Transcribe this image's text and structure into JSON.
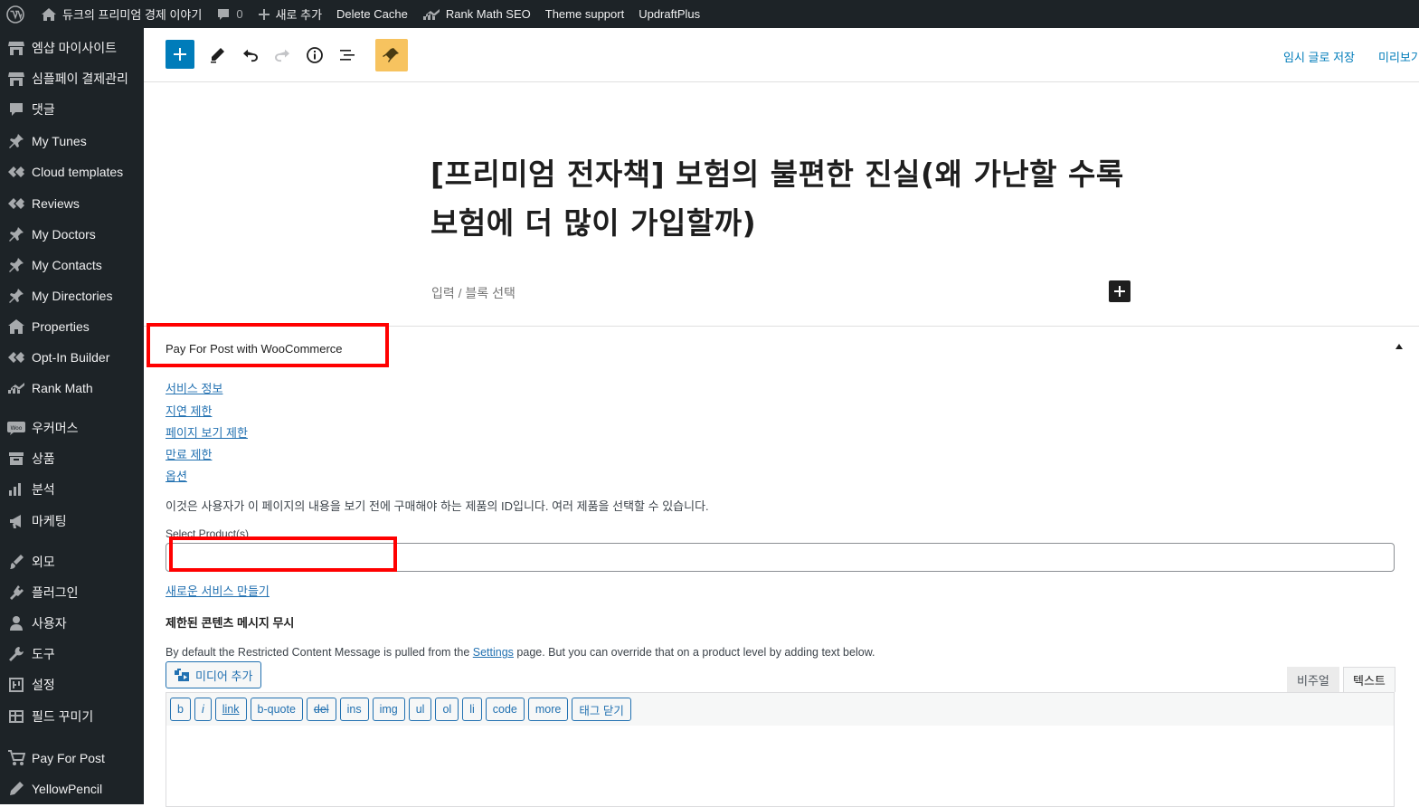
{
  "adminbar": {
    "site_name": "듀크의 프리미엄 경제 이야기",
    "comments_count": "0",
    "new_label": "새로 추가",
    "delete_cache": "Delete Cache",
    "rank_math": "Rank Math SEO",
    "theme_support": "Theme support",
    "updraftplus": "UpdraftPlus"
  },
  "sidebar": {
    "items": [
      {
        "label": "엠샵 마이사이트",
        "icon": "store-icon"
      },
      {
        "label": "심플페이 결제관리",
        "icon": "store-icon"
      },
      {
        "label": "댓글",
        "icon": "comment-icon"
      },
      {
        "label": "My Tunes",
        "icon": "pin-icon"
      },
      {
        "label": "Cloud templates",
        "icon": "elementor-icon"
      },
      {
        "label": "Reviews",
        "icon": "elementor-icon"
      },
      {
        "label": "My Doctors",
        "icon": "pin-icon"
      },
      {
        "label": "My Contacts",
        "icon": "pin-icon"
      },
      {
        "label": "My Directories",
        "icon": "pin-icon"
      },
      {
        "label": "Properties",
        "icon": "building-icon"
      },
      {
        "label": "Opt-In Builder",
        "icon": "elementor-icon"
      },
      {
        "label": "Rank Math",
        "icon": "rank-math-icon"
      },
      {
        "label": "우커머스",
        "icon": "woo-icon"
      },
      {
        "label": "상품",
        "icon": "archive-icon"
      },
      {
        "label": "분석",
        "icon": "bar-chart-icon"
      },
      {
        "label": "마케팅",
        "icon": "megaphone-icon"
      },
      {
        "label": "외모",
        "icon": "brush-icon"
      },
      {
        "label": "플러그인",
        "icon": "plugin-icon"
      },
      {
        "label": "사용자",
        "icon": "user-icon"
      },
      {
        "label": "도구",
        "icon": "wrench-icon"
      },
      {
        "label": "설정",
        "icon": "settings-icon"
      },
      {
        "label": "필드 꾸미기",
        "icon": "table-icon"
      },
      {
        "label": "Pay For Post",
        "icon": "cart-icon"
      },
      {
        "label": "YellowPencil",
        "icon": "pencil-icon"
      }
    ]
  },
  "toolbar": {
    "save_draft": "임시 글로 저장",
    "preview": "미리보기"
  },
  "post": {
    "title": "[프리미엄 전자책] 보험의 불편한 진실(왜 가난할 수록 보험에 더 많이 가입할까)",
    "appender_placeholder": "입력 / 블록 선택"
  },
  "metabox": {
    "title": "Pay For Post with WooCommerce",
    "links": [
      "서비스 정보",
      "지연 제한",
      "페이지 보기 제한",
      "만료 제한",
      "옵션"
    ],
    "description": "이것은 사용자가 이 페이지의 내용을 보기 전에 구매해야 하는 제품의 ID입니다. 여러 제품을 선택할 수 있습니다.",
    "select_label": "Select Product(s)",
    "new_service_link": "새로운 서비스 만들기",
    "override_heading": "제한된 콘텐츠 메시지 무시",
    "default_text_before": "By default the Restricted Content Message is pulled from the ",
    "default_text_link": "Settings",
    "default_text_after": " page. But you can override that on a product level by adding text below.",
    "media_button": "미디어 추가",
    "tab_visual": "비주얼",
    "tab_text": "텍스트",
    "quicktags": [
      "b",
      "i",
      "link",
      "b-quote",
      "del",
      "ins",
      "img",
      "ul",
      "ol",
      "li",
      "code",
      "more",
      "태그 닫기"
    ]
  },
  "colors": {
    "admin_bg": "#1d2327",
    "accent": "#007cba",
    "annotation": "#ff0000",
    "yellowpencil": "#f7c35f"
  }
}
